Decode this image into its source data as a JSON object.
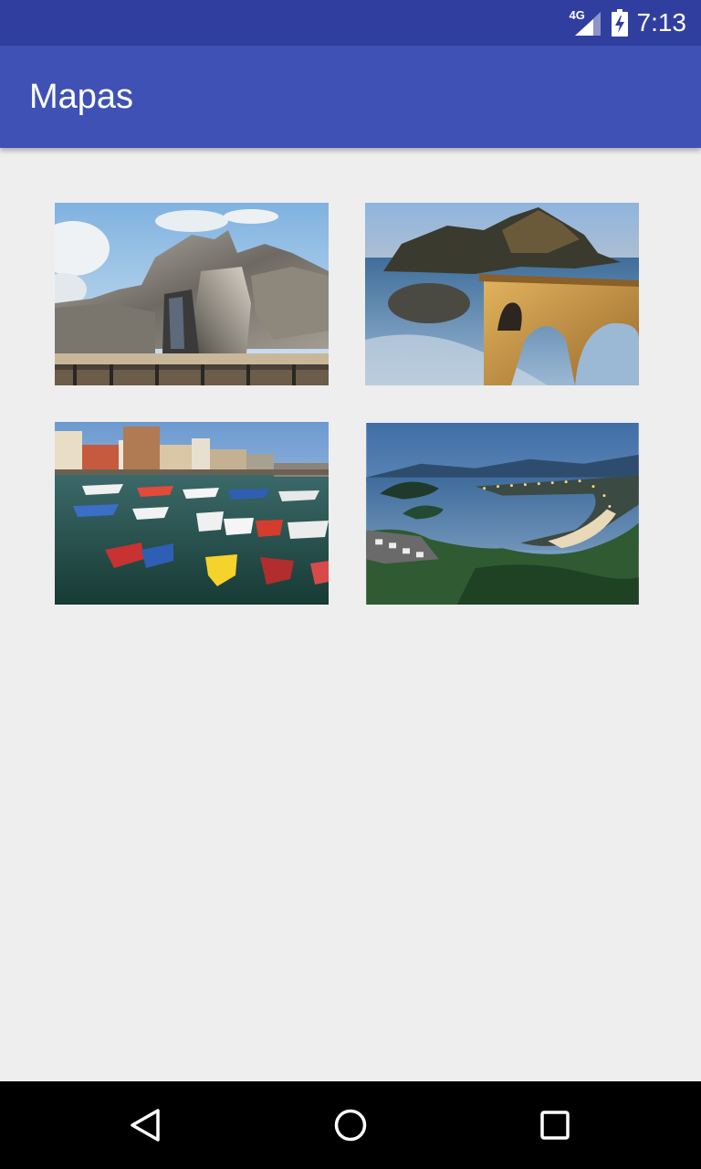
{
  "status_bar": {
    "network_type": "4G",
    "time": "7:13",
    "icons": [
      "signal-icon",
      "battery-charging-icon"
    ]
  },
  "app_bar": {
    "title": "Mapas"
  },
  "gallery": {
    "items": [
      {
        "name": "guggenheim-image"
      },
      {
        "name": "coastal-bridge-image"
      },
      {
        "name": "harbor-boats-image"
      },
      {
        "name": "bay-night-image"
      }
    ]
  },
  "nav_bar": {
    "buttons": [
      "back-icon",
      "home-icon",
      "recents-icon"
    ]
  },
  "colors": {
    "status_bar": "#303f9f",
    "app_bar": "#3f51b5",
    "background": "#eeeeee",
    "nav_bar": "#000000"
  }
}
